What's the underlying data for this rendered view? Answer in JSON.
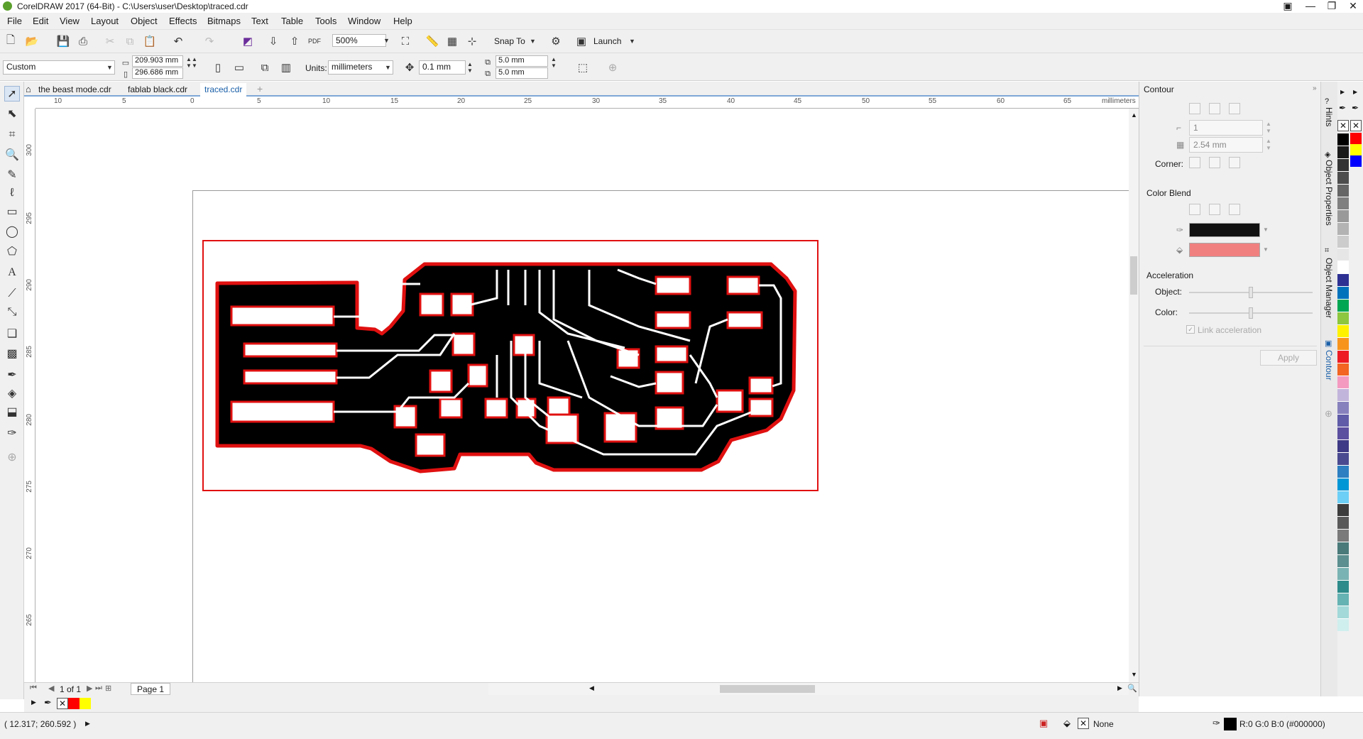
{
  "app": {
    "title": "CorelDRAW 2017 (64-Bit) - C:\\Users\\user\\Desktop\\traced.cdr"
  },
  "menu": [
    "File",
    "Edit",
    "View",
    "Layout",
    "Object",
    "Effects",
    "Bitmaps",
    "Text",
    "Table",
    "Tools",
    "Window",
    "Help"
  ],
  "standard_toolbar": {
    "zoom": "500%",
    "snap_to": "Snap To",
    "launch": "Launch"
  },
  "property_bar": {
    "page_size": "Custom",
    "width": "209.903 mm",
    "height": "296.686 mm",
    "units_label": "Units:",
    "units": "millimeters",
    "nudge": "0.1 mm",
    "dup_x": "5.0 mm",
    "dup_y": "5.0 mm"
  },
  "tabs": [
    "the beast mode.cdr",
    "fablab black.cdr",
    "traced.cdr"
  ],
  "ruler": {
    "unit": "millimeters",
    "h_ticks": [
      "10",
      "5",
      "0",
      "5",
      "10",
      "15",
      "20",
      "25",
      "30",
      "35",
      "40",
      "45",
      "50",
      "55",
      "60",
      "65"
    ],
    "v_ticks": [
      "300",
      "295",
      "290",
      "285",
      "280",
      "275",
      "270",
      "265"
    ]
  },
  "page_nav": {
    "counter": "1 of 1",
    "page_tab": "Page 1"
  },
  "docker": {
    "title": "Contour",
    "steps": "1",
    "offset": "2.54 mm",
    "corner_label": "Corner:",
    "color_blend_label": "Color Blend",
    "acceleration_label": "Acceleration",
    "object_label": "Object:",
    "color_label": "Color:",
    "link_acceleration": "Link acceleration",
    "apply": "Apply",
    "outline_color": "#111111",
    "fill_color": "#f08080"
  },
  "side_tabs": [
    "Hints",
    "Object Properties",
    "Object Manager",
    "Contour"
  ],
  "status": {
    "coords": "( 12.317; 260.592 )",
    "fill_none": "None",
    "color_info": "R:0 G:0 B:0 (#000000)"
  },
  "palette": [
    "#000000",
    "#1a1a1a",
    "#333333",
    "#4d4d4d",
    "#666666",
    "#808080",
    "#999999",
    "#b3b3b3",
    "#cccccc",
    "#e6e6e6",
    "#ffffff",
    "#2e3192",
    "#0072bc",
    "#00a651",
    "#8dc63f",
    "#fff200",
    "#f7941d",
    "#ed1c24",
    "#f26522",
    "#f49ac1",
    "#c2b5db",
    "#8781bd",
    "#605ca8",
    "#5b4fa0",
    "#3e3a85",
    "#4a4a90",
    "#2d7fc1",
    "#0096d6",
    "#6dcff6",
    "#3d3d3d",
    "#595959",
    "#7a7a7a",
    "#4a7a7a",
    "#5c8f8f",
    "#7ab3b3",
    "#2e8b8b",
    "#66b3b3",
    "#a3d9d9",
    "#cfeeee"
  ]
}
